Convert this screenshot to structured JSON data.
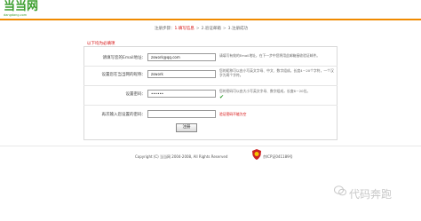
{
  "header": {
    "logo_text": "当当网",
    "logo_sub": "dangdang.com"
  },
  "steps": {
    "prefix": "注册步骤：",
    "step1": "1.填写信息",
    "step2": "2.验证邮箱",
    "step3": "3.注册成功",
    "sep": ">"
  },
  "form": {
    "required_note": "以下均为必填项",
    "email": {
      "label": "请填写您的Email地址：",
      "value": "zswork@qq.com",
      "hint": "请填写有效的Email地址，在下一步中您将用此邮箱接收验证邮件。"
    },
    "nickname": {
      "label": "设置您在当当网的昵称：",
      "value": "zswork",
      "hint": "您的昵称可以由小写英文字母、中文、数字组成，长度4－20个字符，一个汉字为两个字符。"
    },
    "password": {
      "label": "设置密码：",
      "value": "••••••",
      "hint": "您的密码可以由大小写英文字母、数字组成，长度6－20位。"
    },
    "confirm": {
      "label": "再次输入您设置的密码：",
      "value": "",
      "error": "验证密码不能为空"
    },
    "submit_label": "注册"
  },
  "footer": {
    "copyright": "Copyright (C) 当当网 2004-2008, All Rights Reserved",
    "icp": "京ICP证041189号"
  },
  "watermark": {
    "text": "代码奔跑"
  },
  "colors": {
    "accent": "#f08a00",
    "brand": "#3c9e2e",
    "error": "#d40000"
  }
}
